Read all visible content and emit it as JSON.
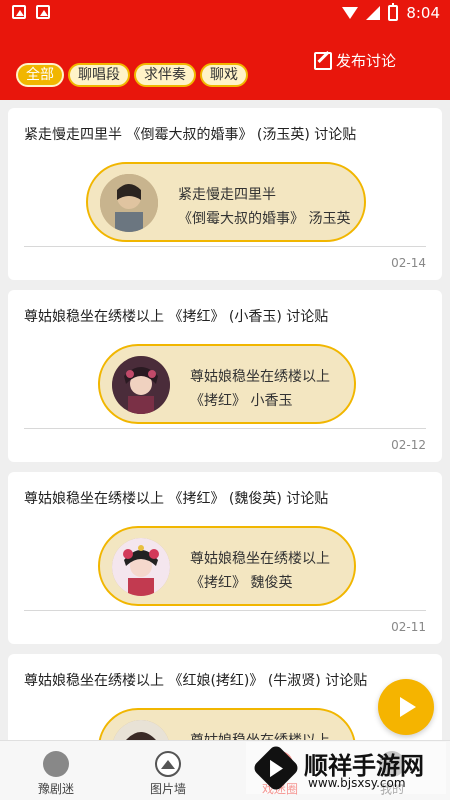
{
  "status_bar": {
    "time": "8:04"
  },
  "header": {
    "tabs": [
      {
        "label": "全部",
        "active": true
      },
      {
        "label": "聊唱段",
        "active": false
      },
      {
        "label": "求伴奏",
        "active": false
      },
      {
        "label": "聊戏",
        "active": false
      }
    ],
    "post_label": "发布讨论"
  },
  "posts": [
    {
      "title": "紧走慢走四里半 《倒霉大叔的婚事》 (汤玉英) 讨论贴",
      "line1": "紧走慢走四里半",
      "line2": "《倒霉大叔的婚事》 汤玉英",
      "date": "02-14"
    },
    {
      "title": "尊姑娘稳坐在绣楼以上 《拷红》 (小香玉) 讨论贴",
      "line1": "尊姑娘稳坐在绣楼以上",
      "line2": "《拷红》 小香玉",
      "date": "02-12"
    },
    {
      "title": "尊姑娘稳坐在绣楼以上 《拷红》 (魏俊英) 讨论贴",
      "line1": "尊姑娘稳坐在绣楼以上",
      "line2": "《拷红》 魏俊英",
      "date": "02-11"
    },
    {
      "title": "尊姑娘稳坐在绣楼以上 《红娘(拷红)》 (牛淑贤) 讨论贴",
      "line1": "尊姑娘稳坐在绣楼以上",
      "line2": "",
      "date": ""
    }
  ],
  "bottom_nav": [
    {
      "label": "豫剧迷",
      "icon": "logo-icon"
    },
    {
      "label": "图片墙",
      "icon": "photo-icon"
    },
    {
      "label": "戏迷圈",
      "icon": "circle-icon",
      "active": true
    },
    {
      "label": "我的",
      "icon": "user-icon"
    }
  ],
  "watermark": {
    "brand": "顺祥手游网",
    "url": "www.bjsxsy.com"
  },
  "colors": {
    "primary": "#e8160c",
    "accent": "#f1b600",
    "capsule_bg": "#f3e6c1"
  }
}
